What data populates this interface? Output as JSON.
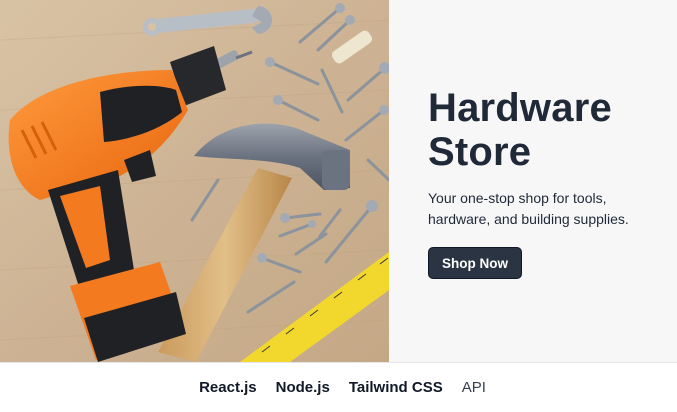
{
  "hero": {
    "title": "Hardware Store",
    "subtitle": "Your one-stop shop for tools, hardware, and building supplies.",
    "cta_label": "Shop Now",
    "image_icon": "tools-photo"
  },
  "footer": {
    "items": [
      "React.js",
      "Node.js",
      "Tailwind CSS",
      "API"
    ]
  },
  "colors": {
    "drill_orange": "#f47a1f",
    "button_bg": "#2b3442",
    "title_text": "#1f2937"
  }
}
